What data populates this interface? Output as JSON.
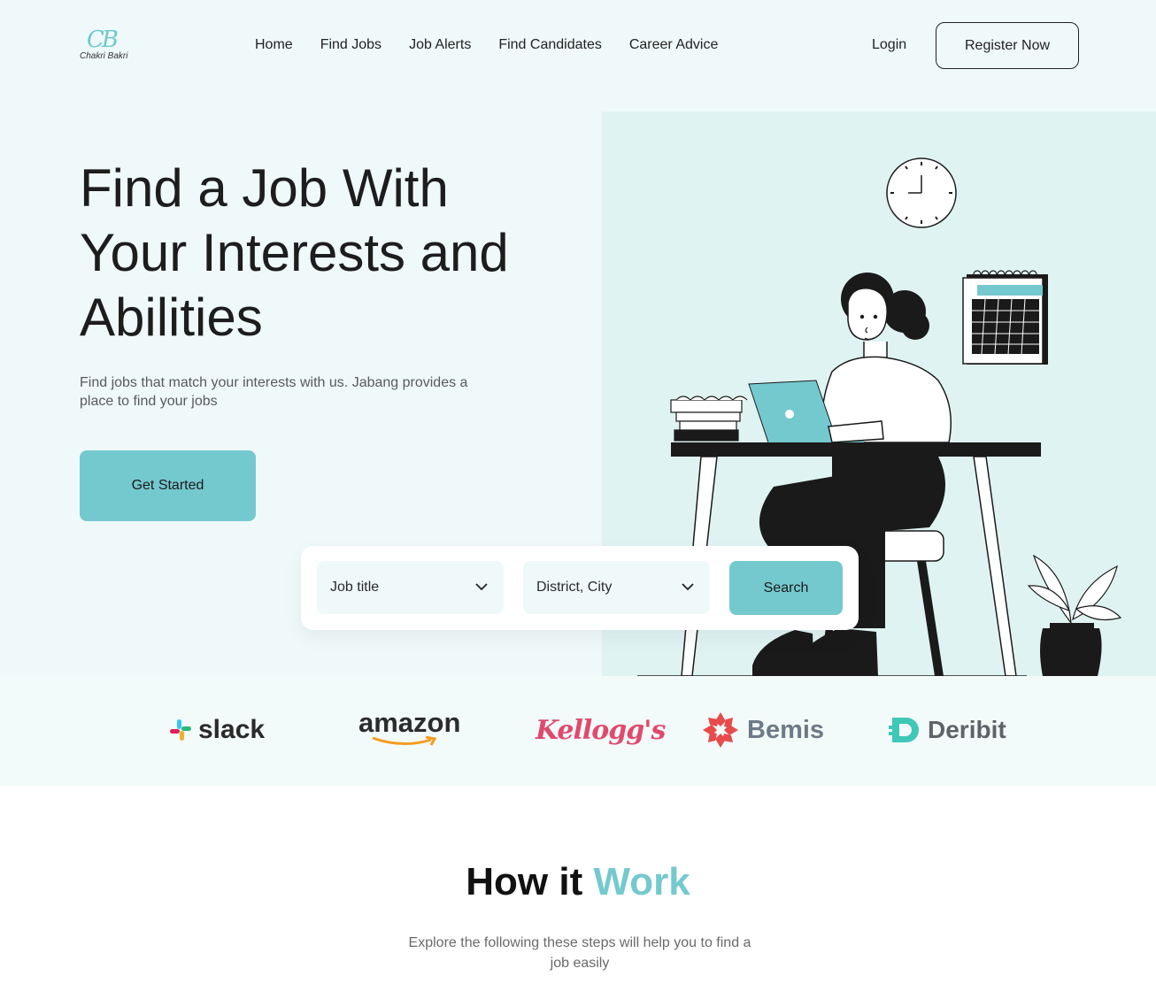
{
  "brand": {
    "logo_mark": "CB",
    "logo_text": "Chakri Bakri"
  },
  "nav": {
    "items": [
      {
        "label": "Home"
      },
      {
        "label": "Find Jobs"
      },
      {
        "label": "Job Alerts"
      },
      {
        "label": "Find Candidates"
      },
      {
        "label": "Career Advice"
      }
    ],
    "login": "Login",
    "register": "Register Now"
  },
  "hero": {
    "headline": "Find a Job With Your Interests and Abilities",
    "subtext": "Find jobs that match your interests with us. Jabang provides a place to find your jobs",
    "cta": "Get Started"
  },
  "search": {
    "job_select": "Job title",
    "location_select": "District, City",
    "button": "Search"
  },
  "partners": {
    "items": [
      {
        "name": "slack"
      },
      {
        "name": "amazon"
      },
      {
        "name": "Kellogg's"
      },
      {
        "name": "Bemis"
      },
      {
        "name": "Deribit"
      }
    ]
  },
  "how": {
    "title_prefix": "How it ",
    "title_accent": "Work",
    "subtitle": "Explore the following these steps will help you to find a job easily"
  },
  "colors": {
    "accent": "#74c9cf",
    "hero_bg": "#eff9fa",
    "art_bg": "#e0f3f3",
    "kelloggs": "#e04a6d"
  },
  "icons": {
    "dropdown": "chevron-down-icon",
    "illustration": "woman-at-desk-illustration"
  }
}
